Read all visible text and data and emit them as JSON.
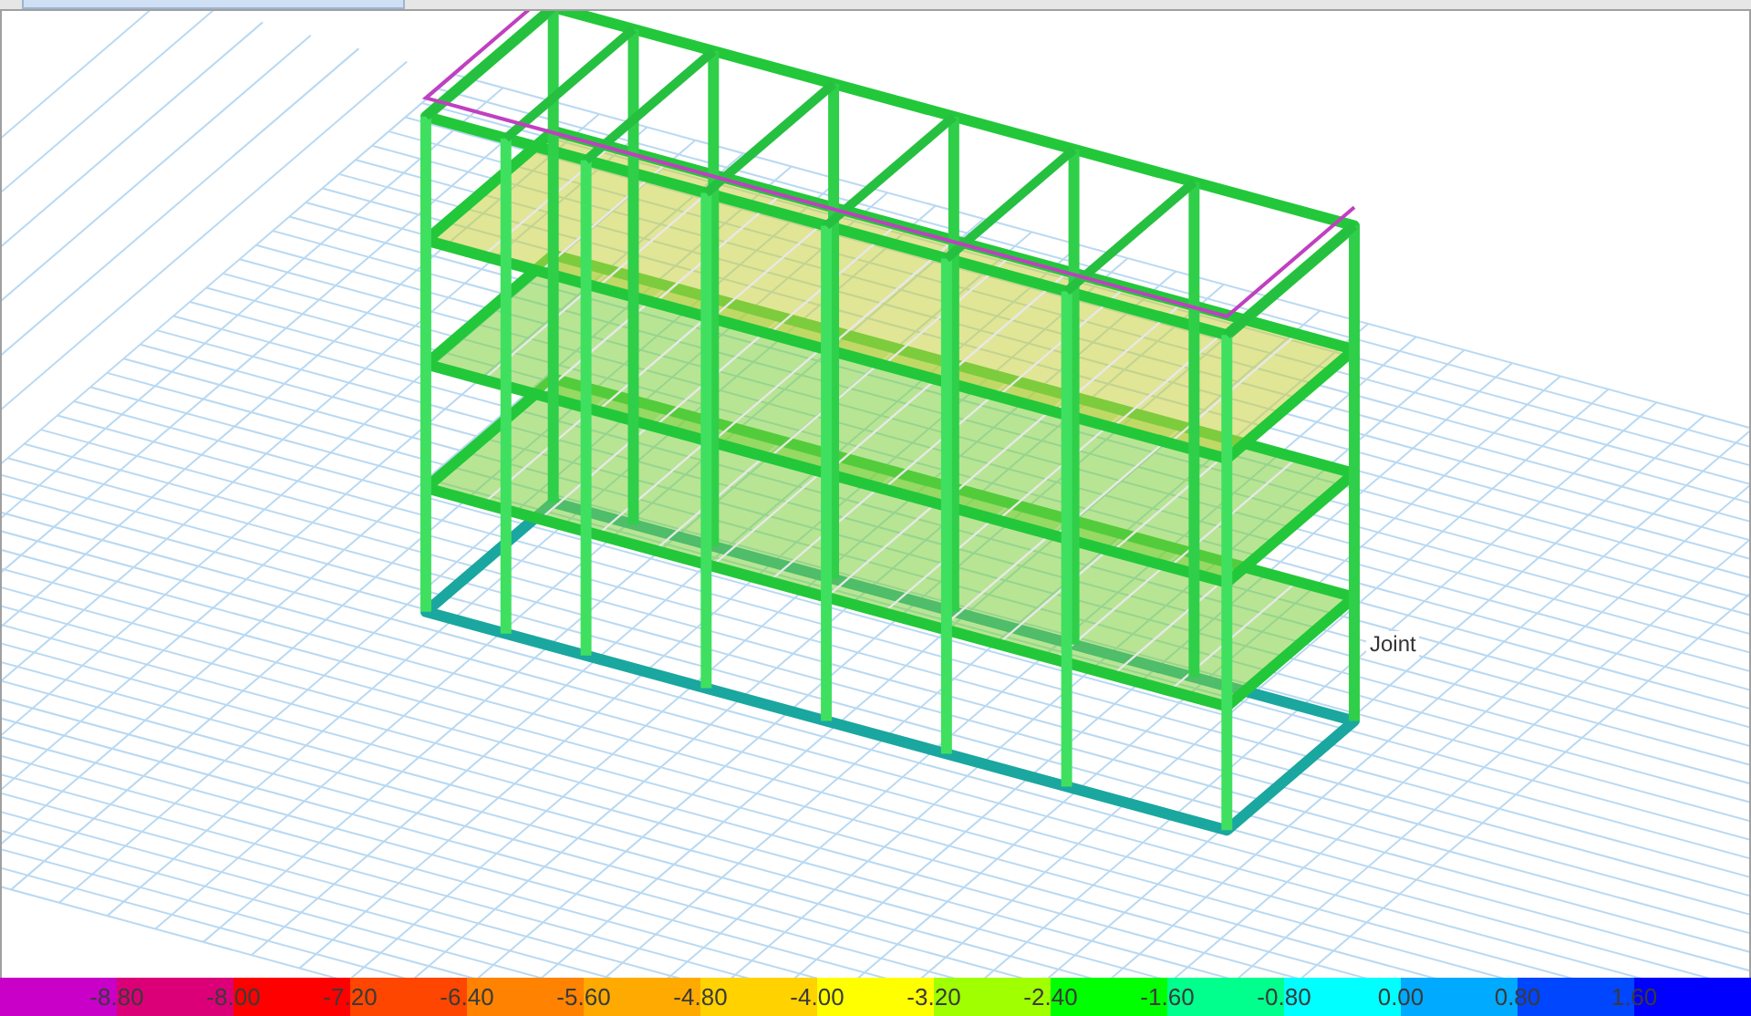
{
  "viewport": {
    "point_label": "Joint"
  },
  "legend": {
    "segments": [
      {
        "color": "#c800c8"
      },
      {
        "color": "#dc0078"
      },
      {
        "color": "#ff0000"
      },
      {
        "color": "#ff4600"
      },
      {
        "color": "#ff8200"
      },
      {
        "color": "#ffaa00"
      },
      {
        "color": "#ffd200"
      },
      {
        "color": "#ffff00"
      },
      {
        "color": "#a0ff00"
      },
      {
        "color": "#00ff00"
      },
      {
        "color": "#00ff8c"
      },
      {
        "color": "#00ffff"
      },
      {
        "color": "#00aaff"
      },
      {
        "color": "#0046ff"
      },
      {
        "color": "#0000ff"
      }
    ],
    "labels": [
      "-8.80",
      "-8.00",
      "-7.20",
      "-6.40",
      "-5.60",
      "-4.80",
      "-4.00",
      "-3.20",
      "-2.40",
      "-1.60",
      "-0.80",
      "0.00",
      "0.80",
      "1.60"
    ]
  }
}
